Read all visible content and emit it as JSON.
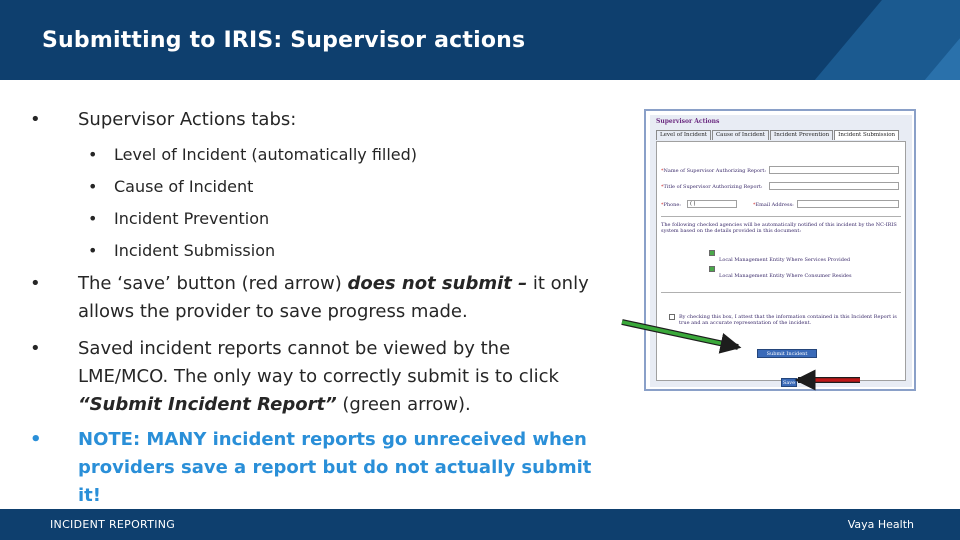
{
  "header": {
    "title": "Submitting to IRIS: Supervisor actions"
  },
  "bullets": {
    "b1": "Supervisor Actions tabs:",
    "sub": [
      "Level of Incident (automatically filled)",
      "Cause of Incident",
      "Incident Prevention",
      "Incident Submission"
    ],
    "b2_pre": "The ‘save’ button (red arrow) ",
    "b2_em": "does not submit –",
    "b2_post": " it only allows the provider to save progress made.",
    "b3_pre": "Saved incident reports cannot be viewed by the LME/MCO. The only way to correctly submit is to click ",
    "b3_em": "“Submit Incident Report”",
    "b3_post": " (green arrow).",
    "b4": "NOTE: MANY incident reports go unreceived when providers save a report but do not actually submit it!"
  },
  "screenshot": {
    "title": "Supervisor Actions",
    "tabs": [
      "Level of Incident",
      "Cause of Incident",
      "Incident Prevention",
      "Incident Submission"
    ],
    "name_label": "Name of Supervisor Authorizing Report:",
    "title_label": "Title of Supervisor Authorizing Report:",
    "phone_label": "Phone:",
    "phone_value": "(   )",
    "email_label": "Email Address:",
    "agencies_text": "The following checked agencies will be automatically notified of this incident by the NC-IRIS system based on the details provided in this document:",
    "agency1": "Local Management Entity Where Services Provided",
    "agency2": "Local Management Entity Where Consumer Resides",
    "attest_text": "By checking this box, I attest that the information contained in this Incident Report is true and an accurate representation of the incident.",
    "submit_button": "Submit Incident Report",
    "save_button": "Save"
  },
  "colors": {
    "header": "#0e3f6e",
    "note": "#2a8fd8",
    "green_arrow": "#3aa83a",
    "red_arrow": "#c01818"
  },
  "footer": {
    "left": "INCIDENT REPORTING",
    "right": "Vaya Health"
  }
}
